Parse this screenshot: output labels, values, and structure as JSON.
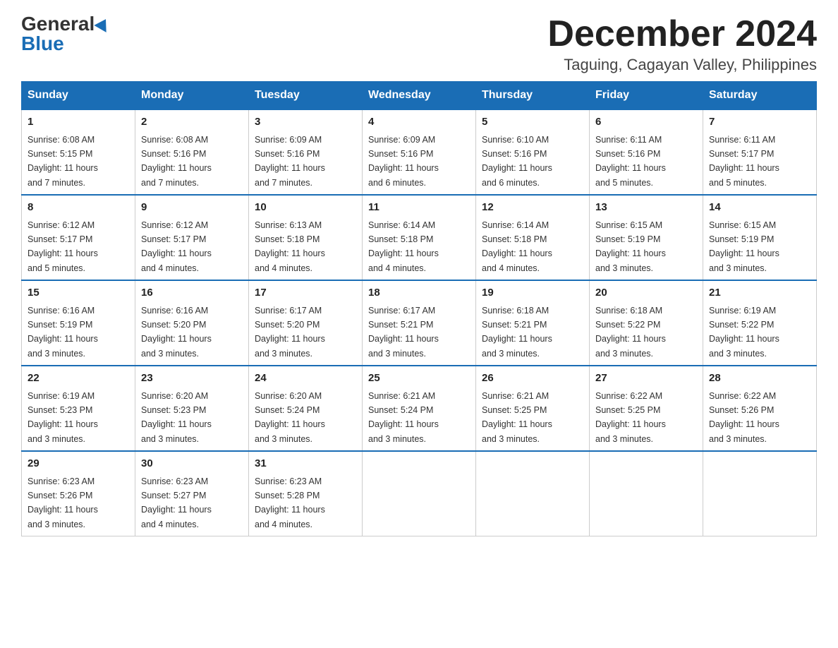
{
  "logo": {
    "general": "General",
    "blue": "Blue"
  },
  "title": {
    "month": "December 2024",
    "location": "Taguing, Cagayan Valley, Philippines"
  },
  "days_of_week": [
    "Sunday",
    "Monday",
    "Tuesday",
    "Wednesday",
    "Thursday",
    "Friday",
    "Saturday"
  ],
  "weeks": [
    [
      {
        "day": "1",
        "sunrise": "6:08 AM",
        "sunset": "5:15 PM",
        "daylight": "11 hours and 7 minutes."
      },
      {
        "day": "2",
        "sunrise": "6:08 AM",
        "sunset": "5:16 PM",
        "daylight": "11 hours and 7 minutes."
      },
      {
        "day": "3",
        "sunrise": "6:09 AM",
        "sunset": "5:16 PM",
        "daylight": "11 hours and 7 minutes."
      },
      {
        "day": "4",
        "sunrise": "6:09 AM",
        "sunset": "5:16 PM",
        "daylight": "11 hours and 6 minutes."
      },
      {
        "day": "5",
        "sunrise": "6:10 AM",
        "sunset": "5:16 PM",
        "daylight": "11 hours and 6 minutes."
      },
      {
        "day": "6",
        "sunrise": "6:11 AM",
        "sunset": "5:16 PM",
        "daylight": "11 hours and 5 minutes."
      },
      {
        "day": "7",
        "sunrise": "6:11 AM",
        "sunset": "5:17 PM",
        "daylight": "11 hours and 5 minutes."
      }
    ],
    [
      {
        "day": "8",
        "sunrise": "6:12 AM",
        "sunset": "5:17 PM",
        "daylight": "11 hours and 5 minutes."
      },
      {
        "day": "9",
        "sunrise": "6:12 AM",
        "sunset": "5:17 PM",
        "daylight": "11 hours and 4 minutes."
      },
      {
        "day": "10",
        "sunrise": "6:13 AM",
        "sunset": "5:18 PM",
        "daylight": "11 hours and 4 minutes."
      },
      {
        "day": "11",
        "sunrise": "6:14 AM",
        "sunset": "5:18 PM",
        "daylight": "11 hours and 4 minutes."
      },
      {
        "day": "12",
        "sunrise": "6:14 AM",
        "sunset": "5:18 PM",
        "daylight": "11 hours and 4 minutes."
      },
      {
        "day": "13",
        "sunrise": "6:15 AM",
        "sunset": "5:19 PM",
        "daylight": "11 hours and 3 minutes."
      },
      {
        "day": "14",
        "sunrise": "6:15 AM",
        "sunset": "5:19 PM",
        "daylight": "11 hours and 3 minutes."
      }
    ],
    [
      {
        "day": "15",
        "sunrise": "6:16 AM",
        "sunset": "5:19 PM",
        "daylight": "11 hours and 3 minutes."
      },
      {
        "day": "16",
        "sunrise": "6:16 AM",
        "sunset": "5:20 PM",
        "daylight": "11 hours and 3 minutes."
      },
      {
        "day": "17",
        "sunrise": "6:17 AM",
        "sunset": "5:20 PM",
        "daylight": "11 hours and 3 minutes."
      },
      {
        "day": "18",
        "sunrise": "6:17 AM",
        "sunset": "5:21 PM",
        "daylight": "11 hours and 3 minutes."
      },
      {
        "day": "19",
        "sunrise": "6:18 AM",
        "sunset": "5:21 PM",
        "daylight": "11 hours and 3 minutes."
      },
      {
        "day": "20",
        "sunrise": "6:18 AM",
        "sunset": "5:22 PM",
        "daylight": "11 hours and 3 minutes."
      },
      {
        "day": "21",
        "sunrise": "6:19 AM",
        "sunset": "5:22 PM",
        "daylight": "11 hours and 3 minutes."
      }
    ],
    [
      {
        "day": "22",
        "sunrise": "6:19 AM",
        "sunset": "5:23 PM",
        "daylight": "11 hours and 3 minutes."
      },
      {
        "day": "23",
        "sunrise": "6:20 AM",
        "sunset": "5:23 PM",
        "daylight": "11 hours and 3 minutes."
      },
      {
        "day": "24",
        "sunrise": "6:20 AM",
        "sunset": "5:24 PM",
        "daylight": "11 hours and 3 minutes."
      },
      {
        "day": "25",
        "sunrise": "6:21 AM",
        "sunset": "5:24 PM",
        "daylight": "11 hours and 3 minutes."
      },
      {
        "day": "26",
        "sunrise": "6:21 AM",
        "sunset": "5:25 PM",
        "daylight": "11 hours and 3 minutes."
      },
      {
        "day": "27",
        "sunrise": "6:22 AM",
        "sunset": "5:25 PM",
        "daylight": "11 hours and 3 minutes."
      },
      {
        "day": "28",
        "sunrise": "6:22 AM",
        "sunset": "5:26 PM",
        "daylight": "11 hours and 3 minutes."
      }
    ],
    [
      {
        "day": "29",
        "sunrise": "6:23 AM",
        "sunset": "5:26 PM",
        "daylight": "11 hours and 3 minutes."
      },
      {
        "day": "30",
        "sunrise": "6:23 AM",
        "sunset": "5:27 PM",
        "daylight": "11 hours and 4 minutes."
      },
      {
        "day": "31",
        "sunrise": "6:23 AM",
        "sunset": "5:28 PM",
        "daylight": "11 hours and 4 minutes."
      },
      null,
      null,
      null,
      null
    ]
  ],
  "labels": {
    "sunrise": "Sunrise:",
    "sunset": "Sunset:",
    "daylight": "Daylight:"
  }
}
